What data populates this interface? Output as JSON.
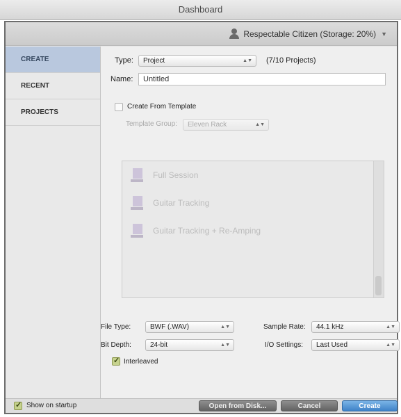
{
  "window": {
    "title": "Dashboard"
  },
  "user": {
    "label": "Respectable Citizen (Storage: 20%)"
  },
  "sidebar": {
    "items": [
      {
        "label": "CREATE"
      },
      {
        "label": "RECENT"
      },
      {
        "label": "PROJECTS"
      }
    ]
  },
  "create": {
    "type_label": "Type:",
    "type_value": "Project",
    "project_count": "(7/10 Projects)",
    "name_label": "Name:",
    "name_value": "Untitled",
    "from_template_label": "Create From Template",
    "template_group_label": "Template Group:",
    "template_group_value": "Eleven Rack",
    "templates": [
      {
        "name": "Full Session"
      },
      {
        "name": "Guitar Tracking"
      },
      {
        "name": "Guitar Tracking + Re-Amping"
      }
    ],
    "file_type_label": "File Type:",
    "file_type_value": "BWF (.WAV)",
    "bit_depth_label": "Bit Depth:",
    "bit_depth_value": "24-bit",
    "sample_rate_label": "Sample Rate:",
    "sample_rate_value": "44.1 kHz",
    "io_settings_label": "I/O Settings:",
    "io_settings_value": "Last Used",
    "interleaved_label": "Interleaved"
  },
  "footer": {
    "show_on_startup_label": "Show on startup",
    "open_from_disk_label": "Open from Disk...",
    "cancel_label": "Cancel",
    "create_label": "Create"
  },
  "colors": {
    "active_sidebar": "#b9c8de",
    "checkbox_checked": "#c6d28e",
    "primary_button": "#3f82c8"
  }
}
